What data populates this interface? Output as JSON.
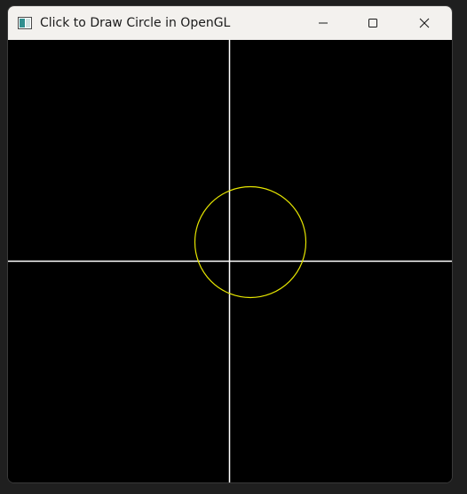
{
  "window": {
    "title": "Click to Draw Circle in OpenGL",
    "controls": {
      "minimize": "minimize-icon",
      "maximize": "maximize-icon",
      "close": "close-icon"
    }
  },
  "canvas": {
    "background": "#000000",
    "axis_color": "#ffffff",
    "circle_color": "#e6e600"
  }
}
